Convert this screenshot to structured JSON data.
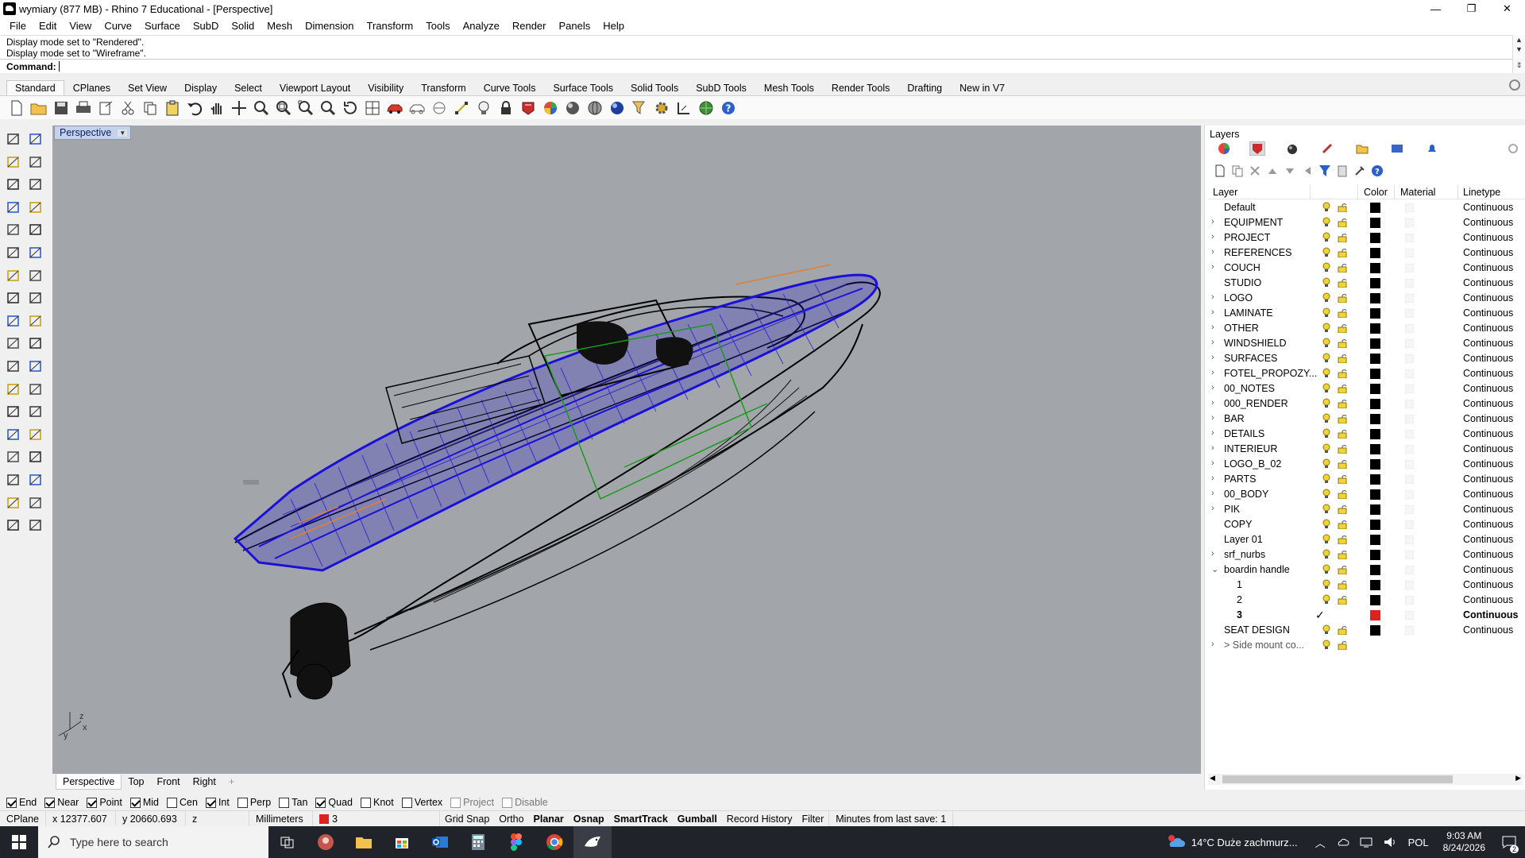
{
  "window": {
    "title": "wymiary (877 MB) - Rhino 7 Educational - [Perspective]",
    "minimize": "—",
    "restore": "❐",
    "close": "✕"
  },
  "menu": [
    "File",
    "Edit",
    "View",
    "Curve",
    "Surface",
    "SubD",
    "Solid",
    "Mesh",
    "Dimension",
    "Transform",
    "Tools",
    "Analyze",
    "Render",
    "Panels",
    "Help"
  ],
  "command": {
    "history": [
      "Display mode set to \"Rendered\".",
      "Display mode set to \"Wireframe\"."
    ],
    "label": "Command:"
  },
  "toolbar_tabs": [
    "Standard",
    "CPlanes",
    "Set View",
    "Display",
    "Select",
    "Viewport Layout",
    "Visibility",
    "Transform",
    "Curve Tools",
    "Surface Tools",
    "Solid Tools",
    "SubD Tools",
    "Mesh Tools",
    "Render Tools",
    "Drafting",
    "New in V7"
  ],
  "viewport": {
    "name": "Perspective",
    "dropdown": "▼",
    "axis_x": "x",
    "axis_y": "y",
    "axis_z": "z"
  },
  "view_tabs": [
    "Perspective",
    "Top",
    "Front",
    "Right",
    "+"
  ],
  "osnaps": [
    {
      "label": "End",
      "checked": true
    },
    {
      "label": "Near",
      "checked": true
    },
    {
      "label": "Point",
      "checked": true
    },
    {
      "label": "Mid",
      "checked": true
    },
    {
      "label": "Cen",
      "checked": false
    },
    {
      "label": "Int",
      "checked": true
    },
    {
      "label": "Perp",
      "checked": false
    },
    {
      "label": "Tan",
      "checked": false
    },
    {
      "label": "Quad",
      "checked": true
    },
    {
      "label": "Knot",
      "checked": false
    },
    {
      "label": "Vertex",
      "checked": false
    },
    {
      "label": "Project",
      "checked": false,
      "disabled": true
    },
    {
      "label": "Disable",
      "checked": false,
      "disabled": true
    }
  ],
  "status": {
    "cplane": "CPlane",
    "x": "x 12377.607",
    "y": "y 20660.693",
    "z": "z",
    "units": "Millimeters",
    "layer": "3",
    "layer_color": "#e0221e",
    "buttons": [
      {
        "label": "Grid Snap",
        "on": false
      },
      {
        "label": "Ortho",
        "on": false
      },
      {
        "label": "Planar",
        "on": true
      },
      {
        "label": "Osnap",
        "on": true
      },
      {
        "label": "SmartTrack",
        "on": true
      },
      {
        "label": "Gumball",
        "on": true
      },
      {
        "label": "Record History",
        "on": false
      },
      {
        "label": "Filter",
        "on": false
      }
    ],
    "save_info": "Minutes from last save: 1"
  },
  "layers_panel": {
    "title": "Layers",
    "columns": {
      "layer": "Layer",
      "color": "Color",
      "material": "Material",
      "linetype": "Linetype"
    },
    "rows": [
      {
        "name": "Default",
        "indent": 0,
        "expand": "",
        "color": "#000000",
        "linetype": "Continuous"
      },
      {
        "name": "EQUIPMENT",
        "indent": 0,
        "expand": "›",
        "color": "#000000",
        "linetype": "Continuous"
      },
      {
        "name": "PROJECT",
        "indent": 0,
        "expand": "›",
        "color": "#000000",
        "linetype": "Continuous"
      },
      {
        "name": "REFERENCES",
        "indent": 0,
        "expand": "›",
        "color": "#000000",
        "linetype": "Continuous"
      },
      {
        "name": "COUCH",
        "indent": 0,
        "expand": "›",
        "color": "#000000",
        "linetype": "Continuous"
      },
      {
        "name": "STUDIO",
        "indent": 0,
        "expand": "",
        "color": "#000000",
        "linetype": "Continuous"
      },
      {
        "name": "LOGO",
        "indent": 0,
        "expand": "›",
        "color": "#000000",
        "linetype": "Continuous"
      },
      {
        "name": "LAMINATE",
        "indent": 0,
        "expand": "›",
        "color": "#000000",
        "linetype": "Continuous"
      },
      {
        "name": "OTHER",
        "indent": 0,
        "expand": "›",
        "color": "#000000",
        "linetype": "Continuous"
      },
      {
        "name": "WINDSHIELD",
        "indent": 0,
        "expand": "›",
        "color": "#000000",
        "linetype": "Continuous"
      },
      {
        "name": "SURFACES",
        "indent": 0,
        "expand": "›",
        "color": "#000000",
        "linetype": "Continuous"
      },
      {
        "name": "FOTEL_PROPOZY...",
        "indent": 0,
        "expand": "›",
        "color": "#000000",
        "linetype": "Continuous"
      },
      {
        "name": "00_NOTES",
        "indent": 0,
        "expand": "›",
        "color": "#000000",
        "linetype": "Continuous"
      },
      {
        "name": "000_RENDER",
        "indent": 0,
        "expand": "›",
        "color": "#000000",
        "linetype": "Continuous"
      },
      {
        "name": "BAR",
        "indent": 0,
        "expand": "›",
        "color": "#000000",
        "linetype": "Continuous"
      },
      {
        "name": "DETAILS",
        "indent": 0,
        "expand": "›",
        "color": "#000000",
        "linetype": "Continuous"
      },
      {
        "name": "INTERIEUR",
        "indent": 0,
        "expand": "›",
        "color": "#000000",
        "linetype": "Continuous"
      },
      {
        "name": "LOGO_B_02",
        "indent": 0,
        "expand": "›",
        "color": "#000000",
        "linetype": "Continuous"
      },
      {
        "name": "PARTS",
        "indent": 0,
        "expand": "›",
        "color": "#000000",
        "linetype": "Continuous"
      },
      {
        "name": "00_BODY",
        "indent": 0,
        "expand": "›",
        "color": "#000000",
        "linetype": "Continuous"
      },
      {
        "name": "PIK",
        "indent": 0,
        "expand": "›",
        "color": "#000000",
        "linetype": "Continuous"
      },
      {
        "name": "COPY",
        "indent": 0,
        "expand": "",
        "color": "#000000",
        "linetype": "Continuous"
      },
      {
        "name": "Layer 01",
        "indent": 0,
        "expand": "",
        "color": "#000000",
        "linetype": "Continuous"
      },
      {
        "name": "srf_nurbs",
        "indent": 0,
        "expand": "›",
        "color": "#000000",
        "linetype": "Continuous"
      },
      {
        "name": "boardin handle",
        "indent": 0,
        "expand": "⌄",
        "color": "#000000",
        "linetype": "Continuous"
      },
      {
        "name": "1",
        "indent": 1,
        "expand": "",
        "color": "#000000",
        "linetype": "Continuous"
      },
      {
        "name": "2",
        "indent": 1,
        "expand": "",
        "color": "#000000",
        "linetype": "Continuous"
      },
      {
        "name": "3",
        "indent": 1,
        "expand": "",
        "color": "#e0221e",
        "linetype": "Continuous",
        "current": true
      },
      {
        "name": "SEAT DESIGN",
        "indent": 0,
        "expand": "",
        "color": "#000000",
        "linetype": "Continuous"
      },
      {
        "name": "> Side mount co...",
        "indent": 0,
        "expand": "›",
        "color": "",
        "linetype": "",
        "dim": true
      }
    ]
  },
  "taskbar": {
    "search_placeholder": "Type here to search",
    "weather": "14°C  Duże zachmurz...",
    "language": "POL",
    "time": "9:03 AM",
    "date": "8/24/2026",
    "notifications": "2"
  }
}
